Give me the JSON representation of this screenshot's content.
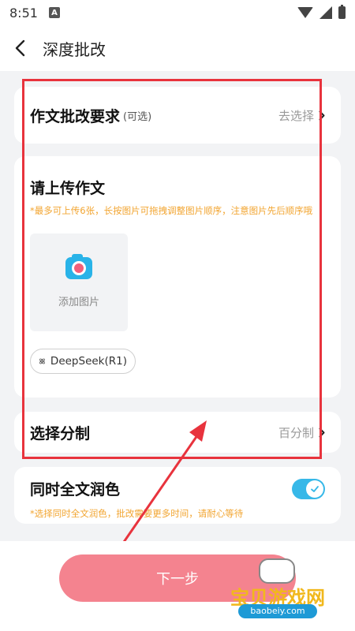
{
  "status_bar": {
    "time": "8:51",
    "notification_letter": "A",
    "icons": [
      "wifi-icon",
      "signal-icon",
      "battery-icon"
    ]
  },
  "nav": {
    "title": "深度批改",
    "back_icon": "chevron-left-icon"
  },
  "requirements": {
    "title": "作文批改要求",
    "optional": "(可选)",
    "action": "去选择"
  },
  "upload": {
    "title": "请上传作文",
    "hint": "*最多可上传6张，长按图片可拖拽调整图片顺序，注意图片先后顺序哦",
    "add_label": "添加图片",
    "model_label": "DeepSeek(R1)"
  },
  "scoring": {
    "title": "选择分制",
    "value": "百分制"
  },
  "polish": {
    "title": "同时全文润色",
    "enabled": true,
    "hint": "*选择同时全文润色，批改需要更多时间，请耐心等待"
  },
  "footer": {
    "next_label": "下一步"
  },
  "watermark": {
    "text": "宝贝游戏网",
    "url": "baobeiy.com"
  },
  "colors": {
    "accent": "#37b8e8",
    "primary_button": "#f4838f",
    "hint_text": "#f2a531",
    "highlight_box": "#e8333d"
  }
}
